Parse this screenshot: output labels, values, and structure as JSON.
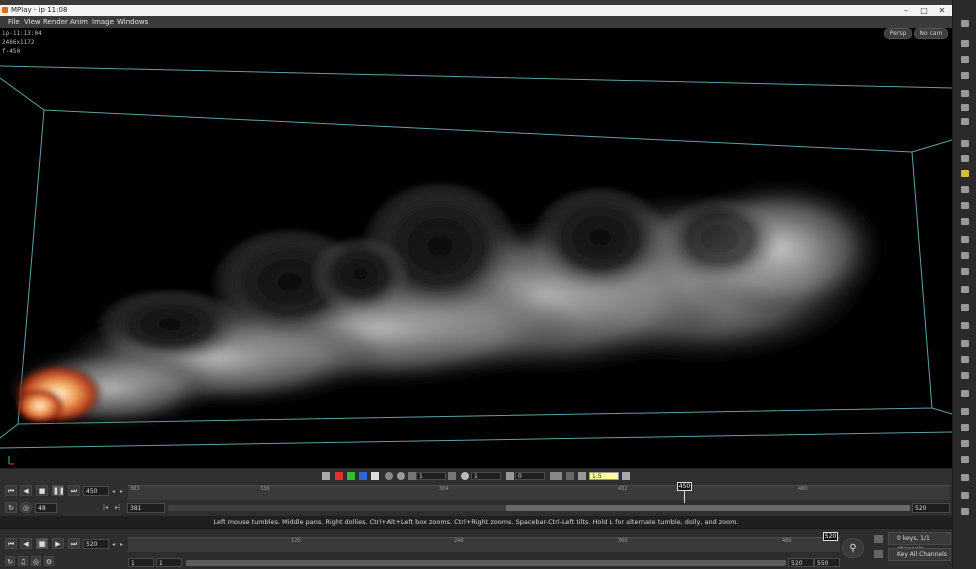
{
  "window": {
    "title": "MPlay - ip 11:08",
    "controls": [
      "minimize",
      "maximize",
      "close"
    ]
  },
  "menubar": [
    "File",
    "View",
    "Render",
    "Anim",
    "Image",
    "Windows"
  ],
  "viewport": {
    "info": {
      "line1": "ip-11:13:04",
      "line2": "2486x1172",
      "line3": "f-450"
    },
    "persp_label": "Persp",
    "cam_label": "No cam"
  },
  "image_toolbar": {
    "exposure_value": "1",
    "gamma_value": "1",
    "field_value": "0",
    "ratio_value": "1:5"
  },
  "playbar": {
    "current_frame": "450",
    "step_value": "48",
    "range_start": "381",
    "range_end": "520",
    "ticks": [
      "383",
      "336",
      "384",
      "432",
      "480"
    ],
    "marker": "450"
  },
  "status_text": "Left mouse tumbles. Middle pans. Right dollies. Ctrl+Alt+Left box zooms. Ctrl+Right zooms. Spacebar-Ctrl-Left tilts. Hold L for alternate tumble, dolly, and zoom.",
  "global_timeline": {
    "current_frame": "520",
    "ticks": [
      "120",
      "240",
      "360",
      "480"
    ],
    "end_marker": "520",
    "start_field_a": "1",
    "start_field_b": "1",
    "end_field_a": "520",
    "end_field_b": "550",
    "keys_label": "0 keys, 1/1 channels",
    "key_all_label": "Key All Channels"
  }
}
